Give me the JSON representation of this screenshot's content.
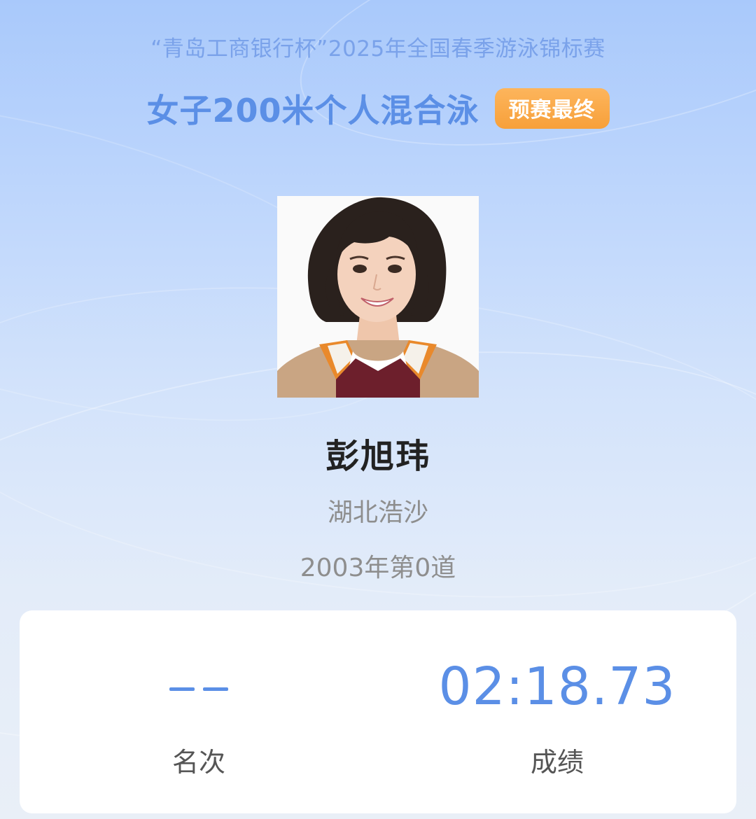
{
  "event": {
    "title": "“青岛工商银行杯”2025年全国春季游泳锦标赛",
    "race_name": "女子200米个人混合泳",
    "stage_badge": "预赛最终"
  },
  "athlete": {
    "name": "彭旭玮",
    "team": "湖北浩沙",
    "lane_info": "2003年第0道"
  },
  "result": {
    "rank_value": "– –",
    "rank_label": "名次",
    "time_value": "02:18.73",
    "time_label": "成绩"
  },
  "colors": {
    "accent_blue": "#5b8fe6",
    "badge_orange": "#f7a03a",
    "title_blue": "#7aa2ea"
  }
}
